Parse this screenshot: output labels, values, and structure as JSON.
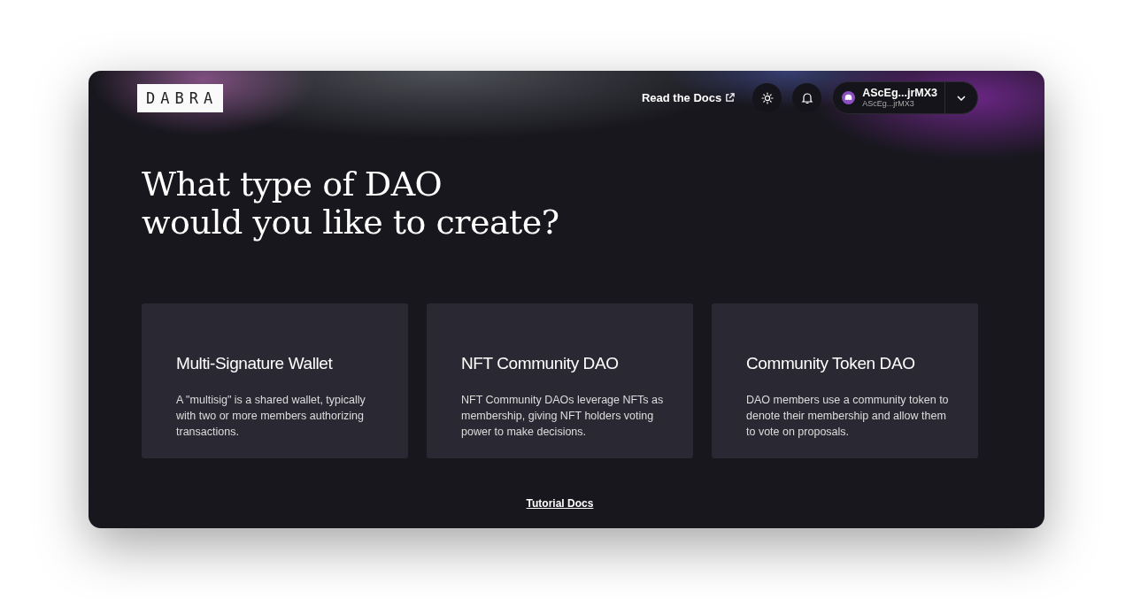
{
  "logo": {
    "text": "DABRA"
  },
  "header": {
    "docs_link": "Read the Docs",
    "wallet": {
      "name": "AScEg...jrMX3",
      "address": "AScEg...jrMX3"
    }
  },
  "heading": {
    "lines": [
      "What type of DAO",
      "would you like to create?"
    ]
  },
  "cards": [
    {
      "title": "Multi-Signature Wallet",
      "description": "A \"multisig\" is a shared wallet, typically with two or more members authorizing transactions."
    },
    {
      "title": "NFT Community DAO",
      "description": "NFT Community DAOs leverage NFTs as membership, giving NFT holders voting power to make decisions."
    },
    {
      "title": "Community Token DAO",
      "description": "DAO members use a community token to denote their membership and allow them to vote on proposals."
    }
  ],
  "footer": {
    "link": "Tutorial Docs"
  }
}
